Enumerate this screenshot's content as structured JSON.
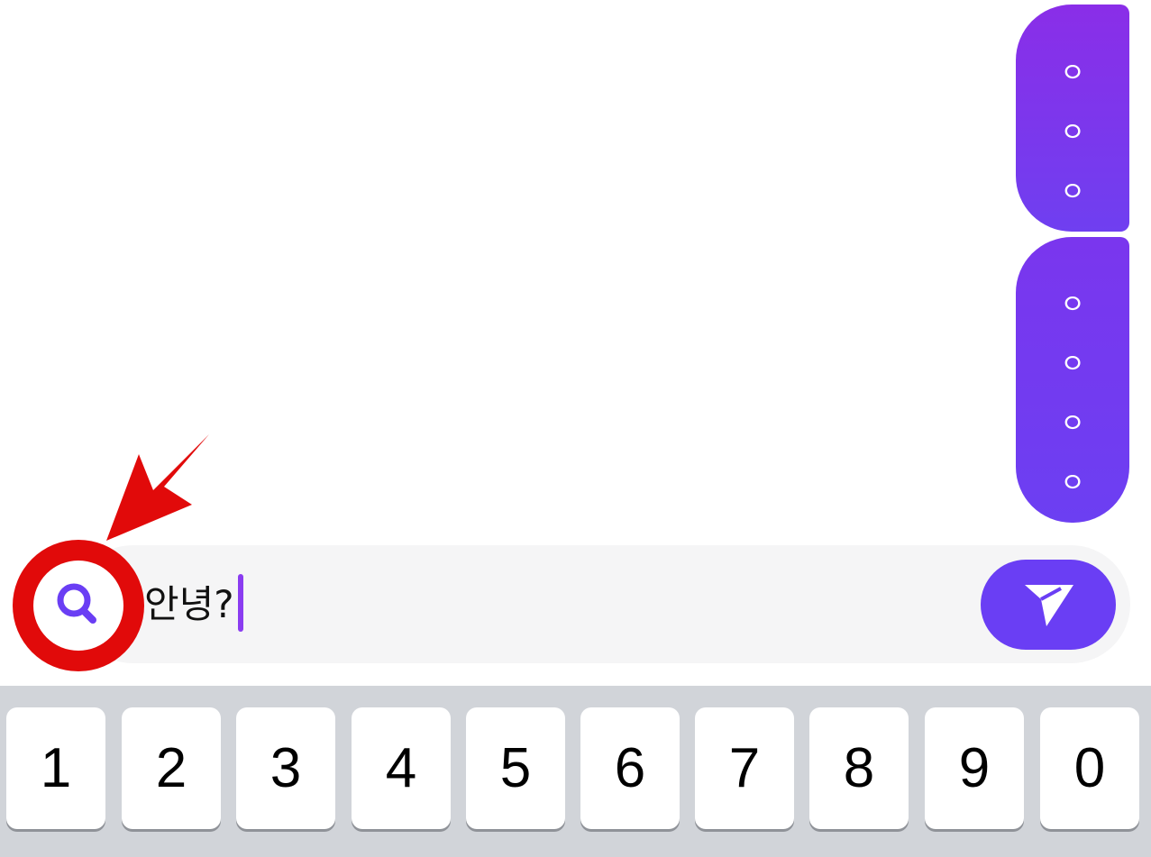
{
  "chat": {
    "messages": [
      {
        "lines": [
          "ㅇ",
          "ㅇ",
          "ㅇ"
        ]
      },
      {
        "lines": [
          "ㅇ",
          "ㅇ",
          "ㅇ",
          "ㅇ"
        ]
      }
    ]
  },
  "composer": {
    "input_value": "안녕?",
    "search_icon": "search-icon",
    "send_icon": "send-icon"
  },
  "keyboard": {
    "keys": [
      "1",
      "2",
      "3",
      "4",
      "5",
      "6",
      "7",
      "8",
      "9",
      "0"
    ]
  },
  "colors": {
    "accent": "#6a3ef4",
    "bubble_top": "#8a2ee8",
    "highlight_red": "#e10a0a",
    "keyboard_bg": "#d1d4d9"
  }
}
